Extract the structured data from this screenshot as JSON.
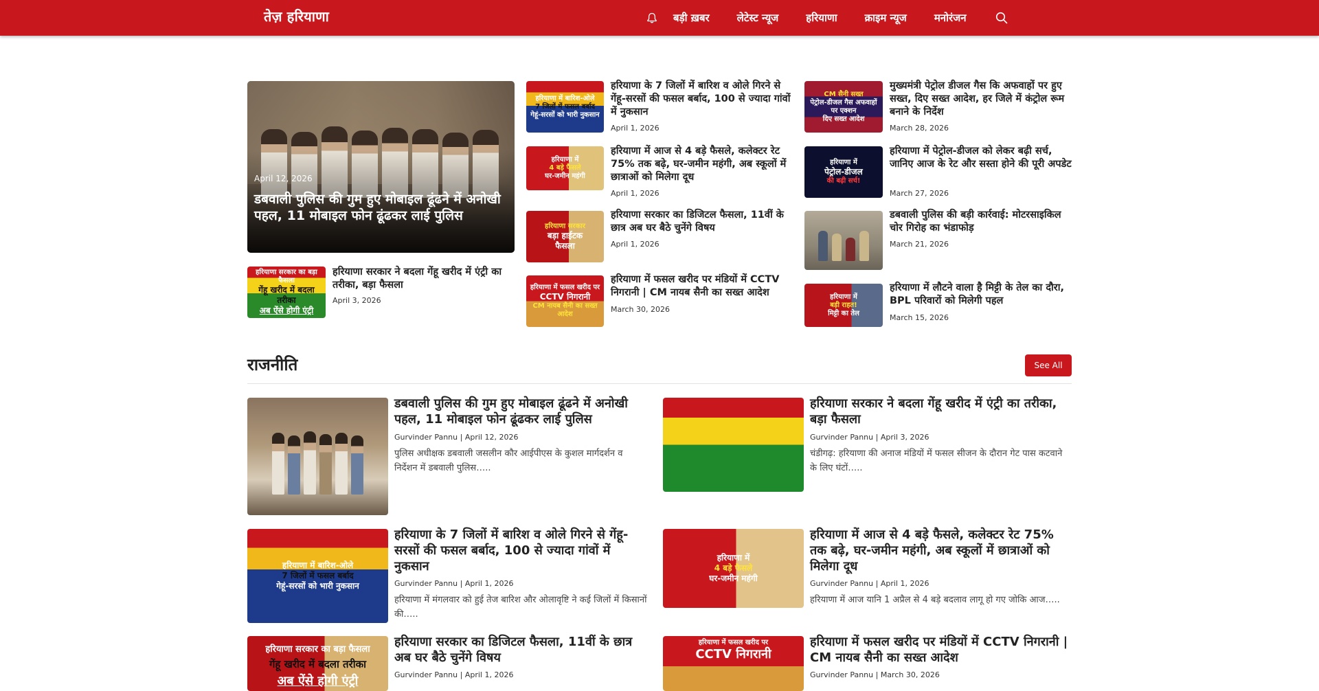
{
  "header": {
    "brand": "तेज़ हरियाणा",
    "nav": [
      "बड़ी ख़बर",
      "लेटेस्ट न्यूज",
      "हरियाणा",
      "क्राइम न्यूज",
      "मनोरंजन"
    ],
    "icons": [
      "bell-icon",
      "search-icon"
    ]
  },
  "colors": {
    "brand_red": "#c8181e",
    "white": "#ffffff",
    "text": "#222222"
  },
  "featured": {
    "date": "April 12, 2026",
    "title": "डबवाली पुलिस की गुम हुए मोबाइल ढूंढने में अनोखी पहल, 11 मोबाइल फोन ढूंढकर लाई पुलिस"
  },
  "col1_small": {
    "title": "हरियाणा सरकार ने बदला गेंहू खरीद में एंट्री का तरीका, बड़ा फैसला",
    "date": "April 3, 2026",
    "thumb": [
      "हरियाणा सरकार का बड़ा फैसला",
      "गेंहू खरीद में बदला तरीका",
      "अब ऐंसे होगी एंट्री"
    ]
  },
  "col2": [
    {
      "title": "हरियाणा के 7 जिलों में बारिश व ओले गिरने से गेंहू-सरसों की फसल बर्बाद, 100 से ज्यादा गांवों में नुकसान",
      "date": "April 1, 2026",
      "thumb": [
        "हरियाणा में बारिश-ओले",
        "7 जिलों में फसल बर्बाद",
        "गेहूं-सरसों को भारी नुकसान"
      ]
    },
    {
      "title": "हरियाणा में आज से 4 बड़े फैसले, कलेक्टर रेट 75% तक बढ़े, घर-जमीन महंगी, अब स्कूलों में छात्राओं को मिलेगा दूध",
      "date": "April 1, 2026",
      "thumb": [
        "हरियाणा में",
        "4 बड़े फैसले",
        "घर-जमीन महंगी"
      ]
    },
    {
      "title": "हरियाणा सरकार का डिजिटल फैसला, 11वीं के छात्र अब घर बैठे चुनेंगे विषय",
      "date": "April 1, 2026",
      "thumb": [
        "हरियाणा सरकार",
        "बड़ा हाईटक",
        "फैसला"
      ]
    },
    {
      "title": "हरियाणा में फसल खरीद पर मंडियों में CCTV निगरानी | CM नायब सैनी का सख्त आदेश",
      "date": "March 30, 2026",
      "thumb": [
        "हरियाणा में फसल खरीद पर",
        "CCTV निगरानी",
        "CM नायब सैनी का सख्त आदेश"
      ]
    }
  ],
  "col3": [
    {
      "title": "मुख्यमंत्री पेट्रोल डीजल गैस कि अफवाहों पर हुए सख्त, दिए सख्त आदेश, हर जिले में कंट्रोल रूम बनाने के निर्देश",
      "date": "March 28, 2026",
      "thumb": [
        "CM सैनी सख्त",
        "पेट्रोल-डीजल गैस अफवाहों पर एक्शन",
        "दिए सख्त आदेश"
      ]
    },
    {
      "title": "हरियाणा में पेट्रोल-डीजल को लेकर बढ़ी सर्च, जानिए आज के रेट और सस्ता होने की पूरी अपडेट",
      "date": "March 27, 2026",
      "thumb": [
        "हरियाणा में",
        "पेट्रोल-डीजल",
        "की बढ़ी सर्च!"
      ]
    },
    {
      "title": "डबवाली पुलिस की बड़ी कार्रवाई: मोटरसाइकिल चोर गिरोह का भंडाफोड़",
      "date": "March 21, 2026",
      "thumb": [
        "",
        "",
        ""
      ]
    },
    {
      "title": "हरियाणा में लौटने वाला है मिट्टी के तेल का दौरा, BPL परिवारों को मिलेगी पहल",
      "date": "March 15, 2026",
      "thumb": [
        "हरियाणा में",
        "बड़ी राहत!",
        "मिट्टी का तेल"
      ]
    }
  ],
  "section": {
    "title": "राजनीति",
    "see_all": "See All",
    "articles": [
      {
        "title": "डबवाली पुलिस की गुम हुए मोबाइल ढूंढने में अनोखी पहल, 11 मोबाइल फोन ढूंढकर लाई पुलिस",
        "author": "Gurvinder Pannu",
        "date": "April 12, 2026",
        "excerpt": "  पुलिस अधीक्षक डबवाली जसलीन कौर आईपीएस के कुशल मार्गदर्शन व निर्देशन में डबवाली पुलिस….."
      },
      {
        "title": "हरियाणा सरकार ने बदला गेंहू खरीद में एंट्री का तरीका, बड़ा फैसला",
        "author": "Gurvinder Pannu",
        "date": "April 3, 2026",
        "excerpt": "चंडीगढ़: हरियाणा की अनाज मंडियों में फसल सीजन के दौरान गेट पास कटवाने के लिए घंटों….."
      },
      {
        "title": "हरियाणा के 7 जिलों में बारिश व ओले गिरने से गेंहू-सरसों की फसल बर्बाद, 100 से ज्यादा गांवों में नुकसान",
        "author": "Gurvinder Pannu",
        "date": "April 1, 2026",
        "excerpt": "हरियाणा में मंगलवार को हुई तेज बारिश और ओलावृष्टि ने कई जिलों में किसानों की….."
      },
      {
        "title": "हरियाणा में आज से 4 बड़े फैसले, कलेक्टर रेट 75% तक बढ़े, घर-जमीन महंगी, अब स्कूलों में छात्राओं को मिलेगा दूध",
        "author": "Gurvinder Pannu",
        "date": "April 1, 2026",
        "excerpt": "हरियाणा में आज यानि 1 अप्रैल से 4 बड़े बदलाव लागू हो गए जोकि आज….."
      },
      {
        "title": "हरियाणा सरकार का डिजिटल फैसला, 11वीं के छात्र अब घर बैठे चुनेंगे विषय",
        "author": "Gurvinder Pannu",
        "date": "April 1, 2026",
        "excerpt": ""
      },
      {
        "title": "हरियाणा में फसल खरीद पर मंडियों में CCTV निगरानी | CM नायब सैनी का सख्त आदेश",
        "author": "Gurvinder Pannu",
        "date": "March 30, 2026",
        "excerpt": ""
      }
    ]
  }
}
